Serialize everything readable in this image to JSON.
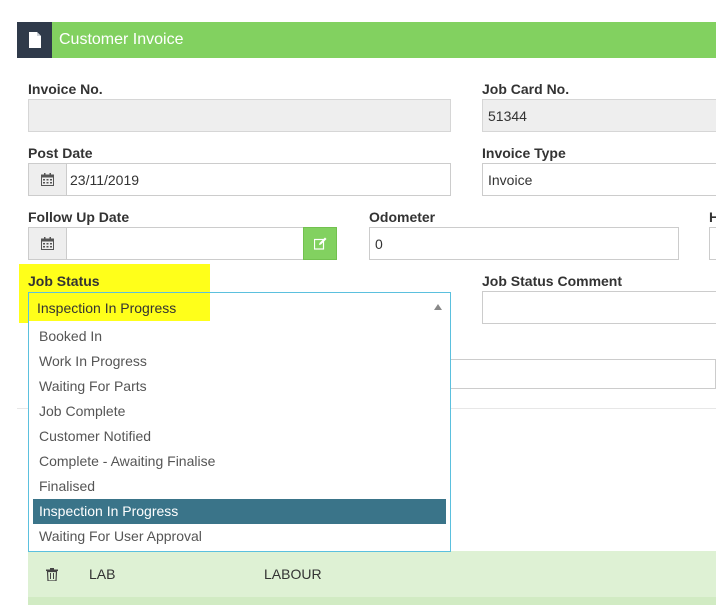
{
  "header": {
    "title": "Customer Invoice",
    "icon": "document-icon"
  },
  "fields": {
    "invoice_no": {
      "label": "Invoice No.",
      "value": ""
    },
    "job_card_no": {
      "label": "Job Card No.",
      "value": "51344"
    },
    "post_date": {
      "label": "Post Date",
      "value": "23/11/2019",
      "icon": "calendar-icon"
    },
    "invoice_type": {
      "label": "Invoice Type",
      "value": "Invoice"
    },
    "follow_up_date": {
      "label": "Follow Up Date",
      "value": "",
      "icon": "calendar-icon",
      "button_icon": "edit-icon"
    },
    "odometer": {
      "label": "Odometer",
      "value": "0"
    },
    "h_label": {
      "label": "H"
    },
    "job_status": {
      "label": "Job Status",
      "value": "Inspection In Progress",
      "options": [
        "Booked In",
        "Work In Progress",
        "Waiting For Parts",
        "Job Complete",
        "Customer Notified",
        "Complete - Awaiting Finalise",
        "Finalised",
        "Inspection In Progress",
        "Waiting For User Approval"
      ],
      "selected_index": 7
    },
    "job_status_comment": {
      "label": "Job Status Comment",
      "value": ""
    }
  },
  "table": {
    "rows": [
      {
        "icon": "trash-icon",
        "code": "LAB",
        "description": "LABOUR"
      }
    ]
  },
  "colors": {
    "header_green": "#82d160",
    "header_icon_bg": "#2f3a4a",
    "selected_option": "#3a7489",
    "highlight": "#ffff1a",
    "row_green": "#def1d4"
  }
}
